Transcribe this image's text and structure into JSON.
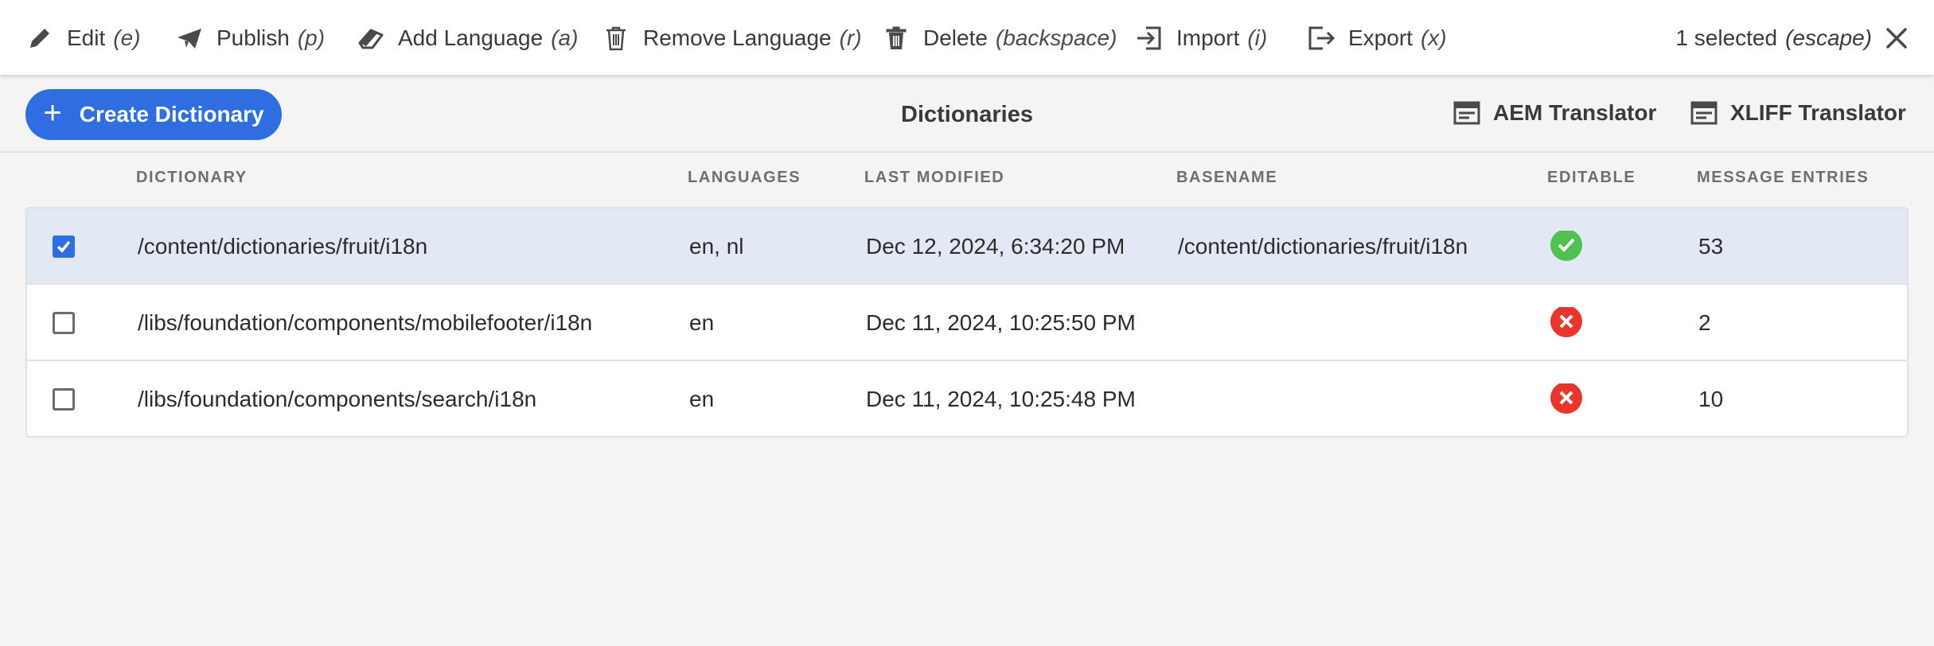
{
  "actions": {
    "edit": {
      "label": "Edit",
      "key": "(e)"
    },
    "publish": {
      "label": "Publish",
      "key": "(p)"
    },
    "add_language": {
      "label": "Add Language",
      "key": "(a)"
    },
    "remove_language": {
      "label": "Remove Language",
      "key": "(r)"
    },
    "delete": {
      "label": "Delete",
      "key": "(backspace)"
    },
    "import": {
      "label": "Import",
      "key": "(i)"
    },
    "export": {
      "label": "Export",
      "key": "(x)"
    }
  },
  "selection": {
    "text": "1 selected",
    "key": "(escape)"
  },
  "toolbar": {
    "create_label": "Create Dictionary",
    "title": "Dictionaries",
    "aem_translator": "AEM Translator",
    "xliff_translator": "XLIFF Translator"
  },
  "table": {
    "headers": {
      "dictionary": "DICTIONARY",
      "languages": "LANGUAGES",
      "last_modified": "LAST MODIFIED",
      "basename": "BASENAME",
      "editable": "EDITABLE",
      "message_entries": "MESSAGE ENTRIES"
    },
    "rows": [
      {
        "dictionary": "/content/dictionaries/fruit/i18n",
        "languages": "en, nl",
        "last_modified": "Dec 12, 2024, 6:34:20 PM",
        "basename": "/content/dictionaries/fruit/i18n",
        "editable": true,
        "entries": "53",
        "selected": true
      },
      {
        "dictionary": "/libs/foundation/components/mobilefooter/i18n",
        "languages": "en",
        "last_modified": "Dec 11, 2024, 10:25:50 PM",
        "basename": "",
        "editable": false,
        "entries": "2",
        "selected": false
      },
      {
        "dictionary": "/libs/foundation/components/search/i18n",
        "languages": "en",
        "last_modified": "Dec 11, 2024, 10:25:48 PM",
        "basename": "",
        "editable": false,
        "entries": "10",
        "selected": false
      }
    ]
  },
  "colors": {
    "accent": "#2e6ee0",
    "selected_row": "#e2e8f4",
    "editable_yes": "#4fc24f",
    "editable_no": "#e8362d"
  },
  "icons": {
    "edit": "pencil-icon",
    "publish": "paper-plane-icon",
    "add_language": "eraser-icon",
    "remove_language": "trash-outline-icon",
    "delete": "trash-icon",
    "import": "import-icon",
    "export": "export-icon",
    "close": "close-icon",
    "translator": "translator-icon",
    "editable_yes": "check-circle-icon",
    "editable_no": "x-circle-icon"
  }
}
